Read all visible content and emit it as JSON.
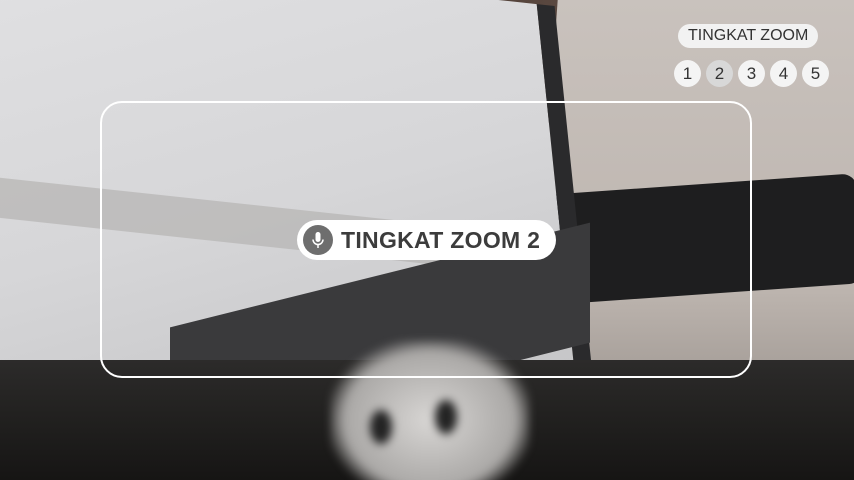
{
  "overlay": {
    "current_zoom_label": "TINGKAT ZOOM 2",
    "mic_icon": "microphone-icon"
  },
  "zoom_levels": {
    "title": "TINGKAT ZOOM",
    "levels": [
      "1",
      "2",
      "3",
      "4",
      "5"
    ],
    "active": "2"
  }
}
